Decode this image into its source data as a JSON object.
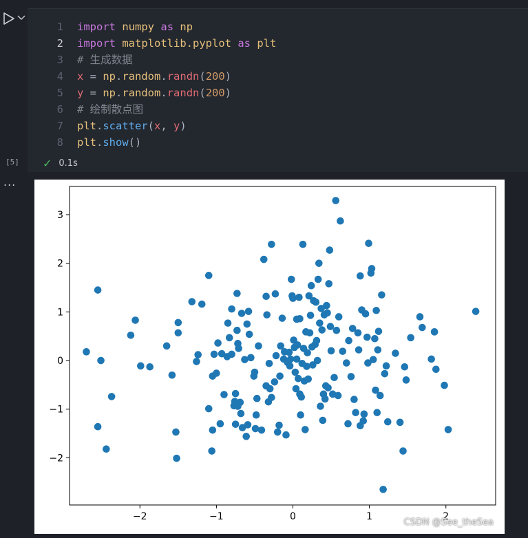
{
  "cell": {
    "execution_count": "[5]",
    "status_time": "0.1s",
    "active_line": 2,
    "lines": [
      {
        "n": "1",
        "tokens": [
          [
            "kw",
            "import"
          ],
          [
            "punc",
            " "
          ],
          [
            "id",
            "numpy"
          ],
          [
            "punc",
            " "
          ],
          [
            "kw",
            "as"
          ],
          [
            "punc",
            " "
          ],
          [
            "id",
            "np"
          ]
        ]
      },
      {
        "n": "2",
        "tokens": [
          [
            "kw",
            "import"
          ],
          [
            "punc",
            " "
          ],
          [
            "id",
            "matplotlib.pyplot"
          ],
          [
            "punc",
            " "
          ],
          [
            "kw",
            "as"
          ],
          [
            "punc",
            " "
          ],
          [
            "id",
            "plt"
          ]
        ]
      },
      {
        "n": "3",
        "tokens": [
          [
            "cm",
            "# 生成数据"
          ]
        ]
      },
      {
        "n": "4",
        "tokens": [
          [
            "var",
            "x"
          ],
          [
            "punc",
            " = "
          ],
          [
            "id",
            "np"
          ],
          [
            "punc",
            "."
          ],
          [
            "id",
            "random"
          ],
          [
            "punc",
            "."
          ],
          [
            "fnred",
            "randn"
          ],
          [
            "punc",
            "("
          ],
          [
            "num",
            "200"
          ],
          [
            "punc",
            ")"
          ]
        ]
      },
      {
        "n": "5",
        "tokens": [
          [
            "var",
            "y"
          ],
          [
            "punc",
            " = "
          ],
          [
            "id",
            "np"
          ],
          [
            "punc",
            "."
          ],
          [
            "id",
            "random"
          ],
          [
            "punc",
            "."
          ],
          [
            "fnred",
            "randn"
          ],
          [
            "punc",
            "("
          ],
          [
            "num",
            "200"
          ],
          [
            "punc",
            ")"
          ]
        ]
      },
      {
        "n": "6",
        "tokens": [
          [
            "cm",
            "# 绘制散点图"
          ]
        ]
      },
      {
        "n": "7",
        "tokens": [
          [
            "id",
            "plt"
          ],
          [
            "punc",
            "."
          ],
          [
            "fn",
            "scatter"
          ],
          [
            "punc",
            "("
          ],
          [
            "var",
            "x"
          ],
          [
            "punc",
            ", "
          ],
          [
            "var",
            "y"
          ],
          [
            "punc",
            ")"
          ]
        ]
      },
      {
        "n": "8",
        "tokens": [
          [
            "id",
            "plt"
          ],
          [
            "punc",
            "."
          ],
          [
            "fn",
            "show"
          ],
          [
            "punc",
            "()"
          ]
        ]
      }
    ]
  },
  "icons": {
    "run": "play-icon",
    "run_menu": "chevron-down-icon",
    "status": "check-icon",
    "output_menu": "ellipsis-icon"
  },
  "output_menu_label": "...",
  "watermark": "CSDN @See_theSea",
  "colors": {
    "marker": "#1f77b4",
    "check": "#4fb862"
  },
  "chart_data": {
    "type": "scatter",
    "title": "",
    "xlabel": "",
    "ylabel": "",
    "xlim": [
      -2.92,
      2.65
    ],
    "ylim": [
      -2.97,
      3.58
    ],
    "xticks": [
      -2,
      -1,
      0,
      1,
      2
    ],
    "yticks": [
      -2,
      -1,
      0,
      1,
      2,
      3
    ],
    "xtick_labels": [
      "−2",
      "−1",
      "0",
      "1",
      "2"
    ],
    "ytick_labels": [
      "−2",
      "−1",
      "0",
      "1",
      "2",
      "3"
    ],
    "grid": false,
    "points": [
      [
        -2.7,
        0.18
      ],
      [
        -2.55,
        1.45
      ],
      [
        -2.55,
        -1.36
      ],
      [
        -2.51,
        0.0
      ],
      [
        -2.44,
        -1.82
      ],
      [
        -2.37,
        -0.74
      ],
      [
        -2.12,
        0.52
      ],
      [
        -2.06,
        0.83
      ],
      [
        -1.99,
        -0.11
      ],
      [
        -1.87,
        -0.13
      ],
      [
        -1.65,
        0.3
      ],
      [
        -1.58,
        -0.3
      ],
      [
        -1.53,
        -1.47
      ],
      [
        -1.52,
        -2.01
      ],
      [
        -1.5,
        0.78
      ],
      [
        -1.5,
        0.57
      ],
      [
        -1.32,
        1.21
      ],
      [
        -1.26,
        -0.02
      ],
      [
        -1.24,
        0.12
      ],
      [
        -1.19,
        1.16
      ],
      [
        -1.1,
        1.75
      ],
      [
        -1.1,
        -0.99
      ],
      [
        -1.06,
        -1.86
      ],
      [
        -1.05,
        -0.32
      ],
      [
        -1.05,
        -1.43
      ],
      [
        -1.03,
        0.13
      ],
      [
        -1.0,
        -0.26
      ],
      [
        -0.98,
        0.36
      ],
      [
        -0.95,
        -1.3
      ],
      [
        -0.93,
        0.14
      ],
      [
        -0.9,
        -0.7
      ],
      [
        -0.86,
        0.08
      ],
      [
        -0.85,
        0.77
      ],
      [
        -0.83,
        0.47
      ],
      [
        -0.8,
        1.06
      ],
      [
        -0.8,
        0.13
      ],
      [
        -0.77,
        -0.93
      ],
      [
        -0.76,
        -0.84
      ],
      [
        -0.75,
        -1.31
      ],
      [
        -0.75,
        -0.68
      ],
      [
        -0.73,
        0.62
      ],
      [
        -0.73,
        1.38
      ],
      [
        -0.72,
        0.35
      ],
      [
        -0.72,
        -0.94
      ],
      [
        -0.71,
        0.25
      ],
      [
        -0.69,
        -0.86
      ],
      [
        -0.68,
        -1.09
      ],
      [
        -0.67,
        0.97
      ],
      [
        -0.66,
        -1.38
      ],
      [
        -0.63,
        0.02
      ],
      [
        -0.61,
        -1.56
      ],
      [
        -0.6,
        0.75
      ],
      [
        -0.59,
        -1.32
      ],
      [
        -0.58,
        1.01
      ],
      [
        -0.57,
        0.54
      ],
      [
        -0.55,
        0.06
      ],
      [
        -0.51,
        -0.32
      ],
      [
        -0.5,
        -0.24
      ],
      [
        -0.49,
        -1.4
      ],
      [
        -0.48,
        -1.12
      ],
      [
        -0.47,
        -0.78
      ],
      [
        -0.45,
        0.3
      ],
      [
        -0.41,
        -1.43
      ],
      [
        -0.38,
        2.08
      ],
      [
        -0.35,
        -0.52
      ],
      [
        -0.35,
        1.32
      ],
      [
        -0.34,
        0.94
      ],
      [
        -0.32,
        -0.85
      ],
      [
        -0.31,
        -0.06
      ],
      [
        -0.3,
        -0.58
      ],
      [
        -0.28,
        -0.76
      ],
      [
        -0.28,
        2.39
      ],
      [
        -0.24,
        -0.44
      ],
      [
        -0.23,
        1.37
      ],
      [
        -0.22,
        0.1
      ],
      [
        -0.2,
        -1.47
      ],
      [
        -0.18,
        -1.33
      ],
      [
        -0.17,
        -0.32
      ],
      [
        -0.16,
        0.3
      ],
      [
        -0.14,
        0.87
      ],
      [
        -0.12,
        0.03
      ],
      [
        -0.11,
        0.18
      ],
      [
        -0.09,
        -1.53
      ],
      [
        -0.07,
        -0.04
      ],
      [
        -0.05,
        0.17
      ],
      [
        -0.04,
        -0.11
      ],
      [
        -0.03,
        0.03
      ],
      [
        -0.02,
        1.67
      ],
      [
        -0.01,
        1.33
      ],
      [
        0.0,
        1.28
      ],
      [
        0.01,
        0.42
      ],
      [
        0.02,
        0.27
      ],
      [
        0.03,
        -0.24
      ],
      [
        0.04,
        -0.58
      ],
      [
        0.05,
        0.85
      ],
      [
        0.05,
        0.03
      ],
      [
        0.06,
        0.32
      ],
      [
        0.07,
        -0.37
      ],
      [
        0.08,
        1.3
      ],
      [
        0.09,
        0.86
      ],
      [
        0.09,
        -0.69
      ],
      [
        0.1,
        -1.12
      ],
      [
        0.11,
        -0.75
      ],
      [
        0.12,
        -0.06
      ],
      [
        0.13,
        2.39
      ],
      [
        0.14,
        0.25
      ],
      [
        0.15,
        -0.42
      ],
      [
        0.16,
        -1.42
      ],
      [
        0.17,
        0.59
      ],
      [
        0.18,
        -0.12
      ],
      [
        0.19,
        0.16
      ],
      [
        0.2,
        -0.38
      ],
      [
        0.21,
        1.33
      ],
      [
        0.22,
        0.57
      ],
      [
        0.23,
        0.93
      ],
      [
        0.24,
        1.54
      ],
      [
        0.25,
        0.28
      ],
      [
        0.26,
        -0.09
      ],
      [
        0.27,
        1.23
      ],
      [
        0.29,
        0.33
      ],
      [
        0.3,
        1.2
      ],
      [
        0.31,
        0.41
      ],
      [
        0.32,
        0.0
      ],
      [
        0.33,
        1.67
      ],
      [
        0.34,
        2.0
      ],
      [
        0.35,
        0.77
      ],
      [
        0.36,
        -0.94
      ],
      [
        0.37,
        1.07
      ],
      [
        0.38,
        0.63
      ],
      [
        0.39,
        -1.23
      ],
      [
        0.4,
        -0.69
      ],
      [
        0.41,
        0.94
      ],
      [
        0.42,
        -0.79
      ],
      [
        0.43,
        -0.52
      ],
      [
        0.44,
        1.13
      ],
      [
        0.45,
        0.98
      ],
      [
        0.46,
        -0.56
      ],
      [
        0.47,
        1.58
      ],
      [
        0.48,
        2.27
      ],
      [
        0.49,
        0.7
      ],
      [
        0.5,
        0.2
      ],
      [
        0.52,
        -0.69
      ],
      [
        0.54,
        -0.35
      ],
      [
        0.56,
        3.29
      ],
      [
        0.57,
        0.62
      ],
      [
        0.59,
        -0.72
      ],
      [
        0.6,
        0.9
      ],
      [
        0.62,
        2.87
      ],
      [
        0.65,
        0.19
      ],
      [
        0.7,
        -0.05
      ],
      [
        0.72,
        -1.3
      ],
      [
        0.73,
        0.41
      ],
      [
        0.76,
        -0.33
      ],
      [
        0.78,
        0.66
      ],
      [
        0.8,
        -0.8
      ],
      [
        0.82,
        -1.07
      ],
      [
        0.85,
        0.57
      ],
      [
        0.86,
        0.22
      ],
      [
        0.88,
        -1.34
      ],
      [
        0.88,
        1.74
      ],
      [
        0.9,
        1.04
      ],
      [
        0.92,
        -1.24
      ],
      [
        0.93,
        -1.1
      ],
      [
        0.95,
        0.96
      ],
      [
        0.97,
        0.48
      ],
      [
        0.98,
        -0.05
      ],
      [
        0.99,
        2.41
      ],
      [
        1.02,
        1.8
      ],
      [
        1.03,
        1.89
      ],
      [
        1.05,
        0.02
      ],
      [
        1.07,
        0.45
      ],
      [
        1.08,
        -0.61
      ],
      [
        1.09,
        1.03
      ],
      [
        1.1,
        -1.07
      ],
      [
        1.11,
        0.22
      ],
      [
        1.12,
        0.6
      ],
      [
        1.14,
        -0.72
      ],
      [
        1.16,
        1.35
      ],
      [
        1.18,
        -2.65
      ],
      [
        1.2,
        -0.27
      ],
      [
        1.22,
        -0.11
      ],
      [
        1.24,
        -1.26
      ],
      [
        1.34,
        0.15
      ],
      [
        1.4,
        -1.27
      ],
      [
        1.44,
        -1.86
      ],
      [
        1.46,
        -0.13
      ],
      [
        1.48,
        -0.4
      ],
      [
        1.54,
        0.47
      ],
      [
        1.66,
        0.9
      ],
      [
        1.69,
        0.68
      ],
      [
        1.81,
        0.03
      ],
      [
        1.85,
        0.59
      ],
      [
        1.87,
        -0.18
      ],
      [
        1.98,
        -0.51
      ],
      [
        2.03,
        -1.42
      ],
      [
        2.39,
        1.01
      ]
    ]
  }
}
